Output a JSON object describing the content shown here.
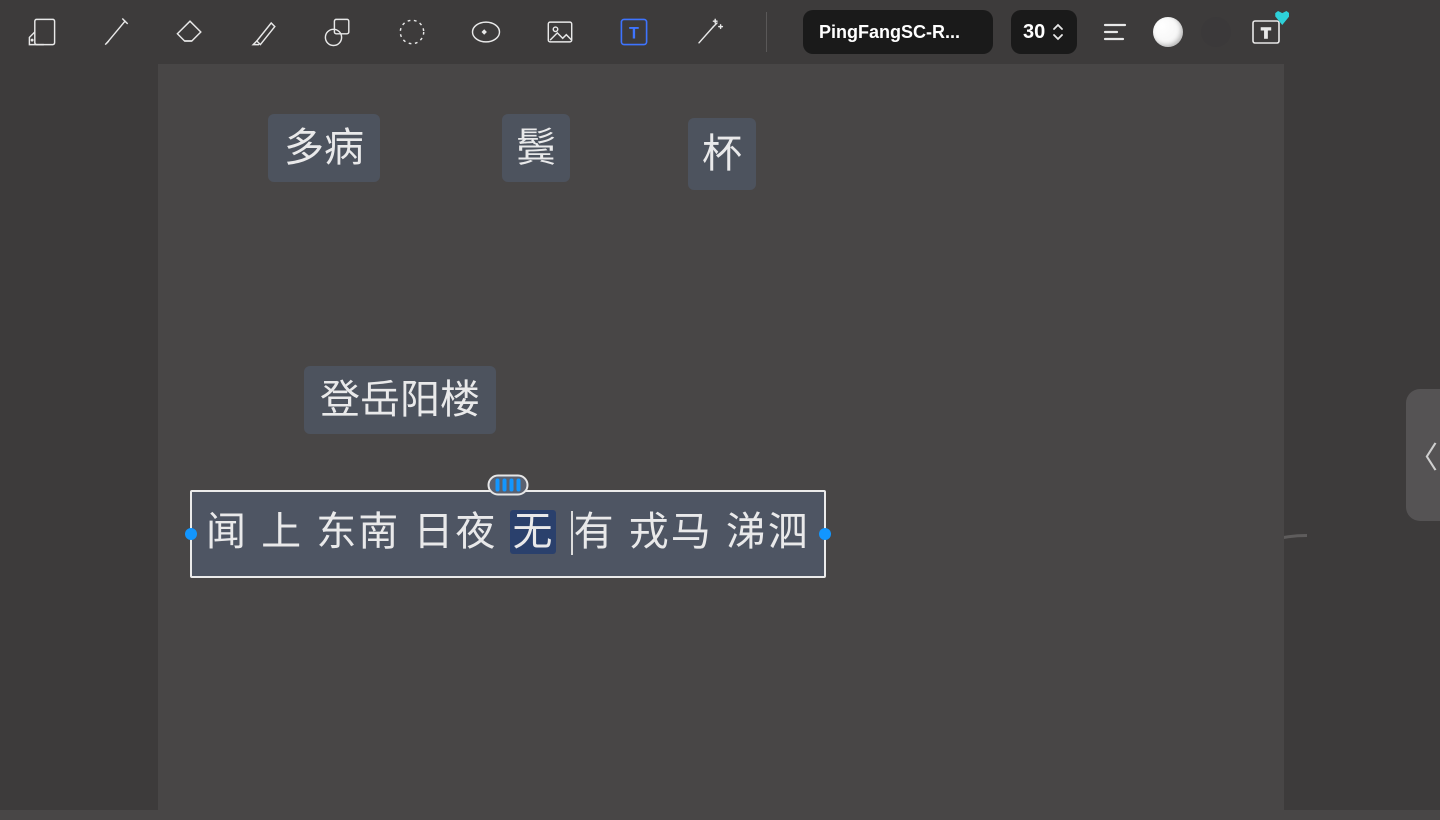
{
  "toolbar": {
    "font_label": "PingFangSC-R...",
    "font_size": "30"
  },
  "chips": {
    "chip1": "多病",
    "chip2": "鬓",
    "chip3": "杯",
    "chip4": "登岳阳楼"
  },
  "active_text": {
    "seg1": "闻 上 东南 日夜 ",
    "sel": "无",
    "seg2": " ",
    "seg3": "有 戎马 涕泗"
  },
  "side_handle_glyph": "〈"
}
